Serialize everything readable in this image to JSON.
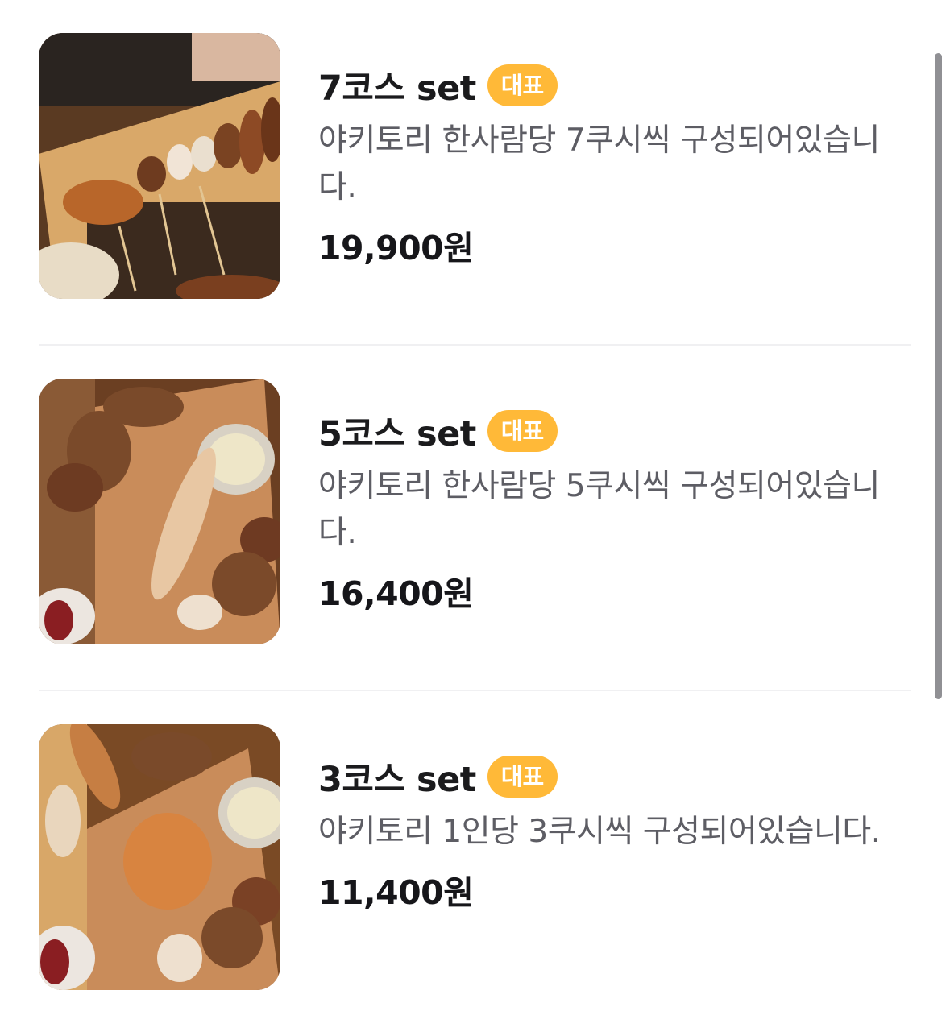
{
  "menu": {
    "items": [
      {
        "title": "7코스 set",
        "badge": "대표",
        "description": "야키토리 한사람당 7쿠시씩 구성되어있습니다.",
        "price": "19,900원",
        "image": "yakitori-7-course-photo"
      },
      {
        "title": "5코스 set",
        "badge": "대표",
        "description": "야키토리 한사람당 5쿠시씩 구성되어있습니다.",
        "price": "16,400원",
        "image": "yakitori-5-course-photo"
      },
      {
        "title": "3코스 set",
        "badge": "대표",
        "description": "야키토리 1인당 3쿠시씩 구성되어있습니다.",
        "price": "11,400원",
        "image": "yakitori-3-course-photo"
      }
    ]
  },
  "colors": {
    "badge": "#ffb938",
    "title": "#1b1b1d",
    "description": "#5d5d64",
    "divider": "#f0f0f2",
    "scrollbar": "#909094"
  }
}
